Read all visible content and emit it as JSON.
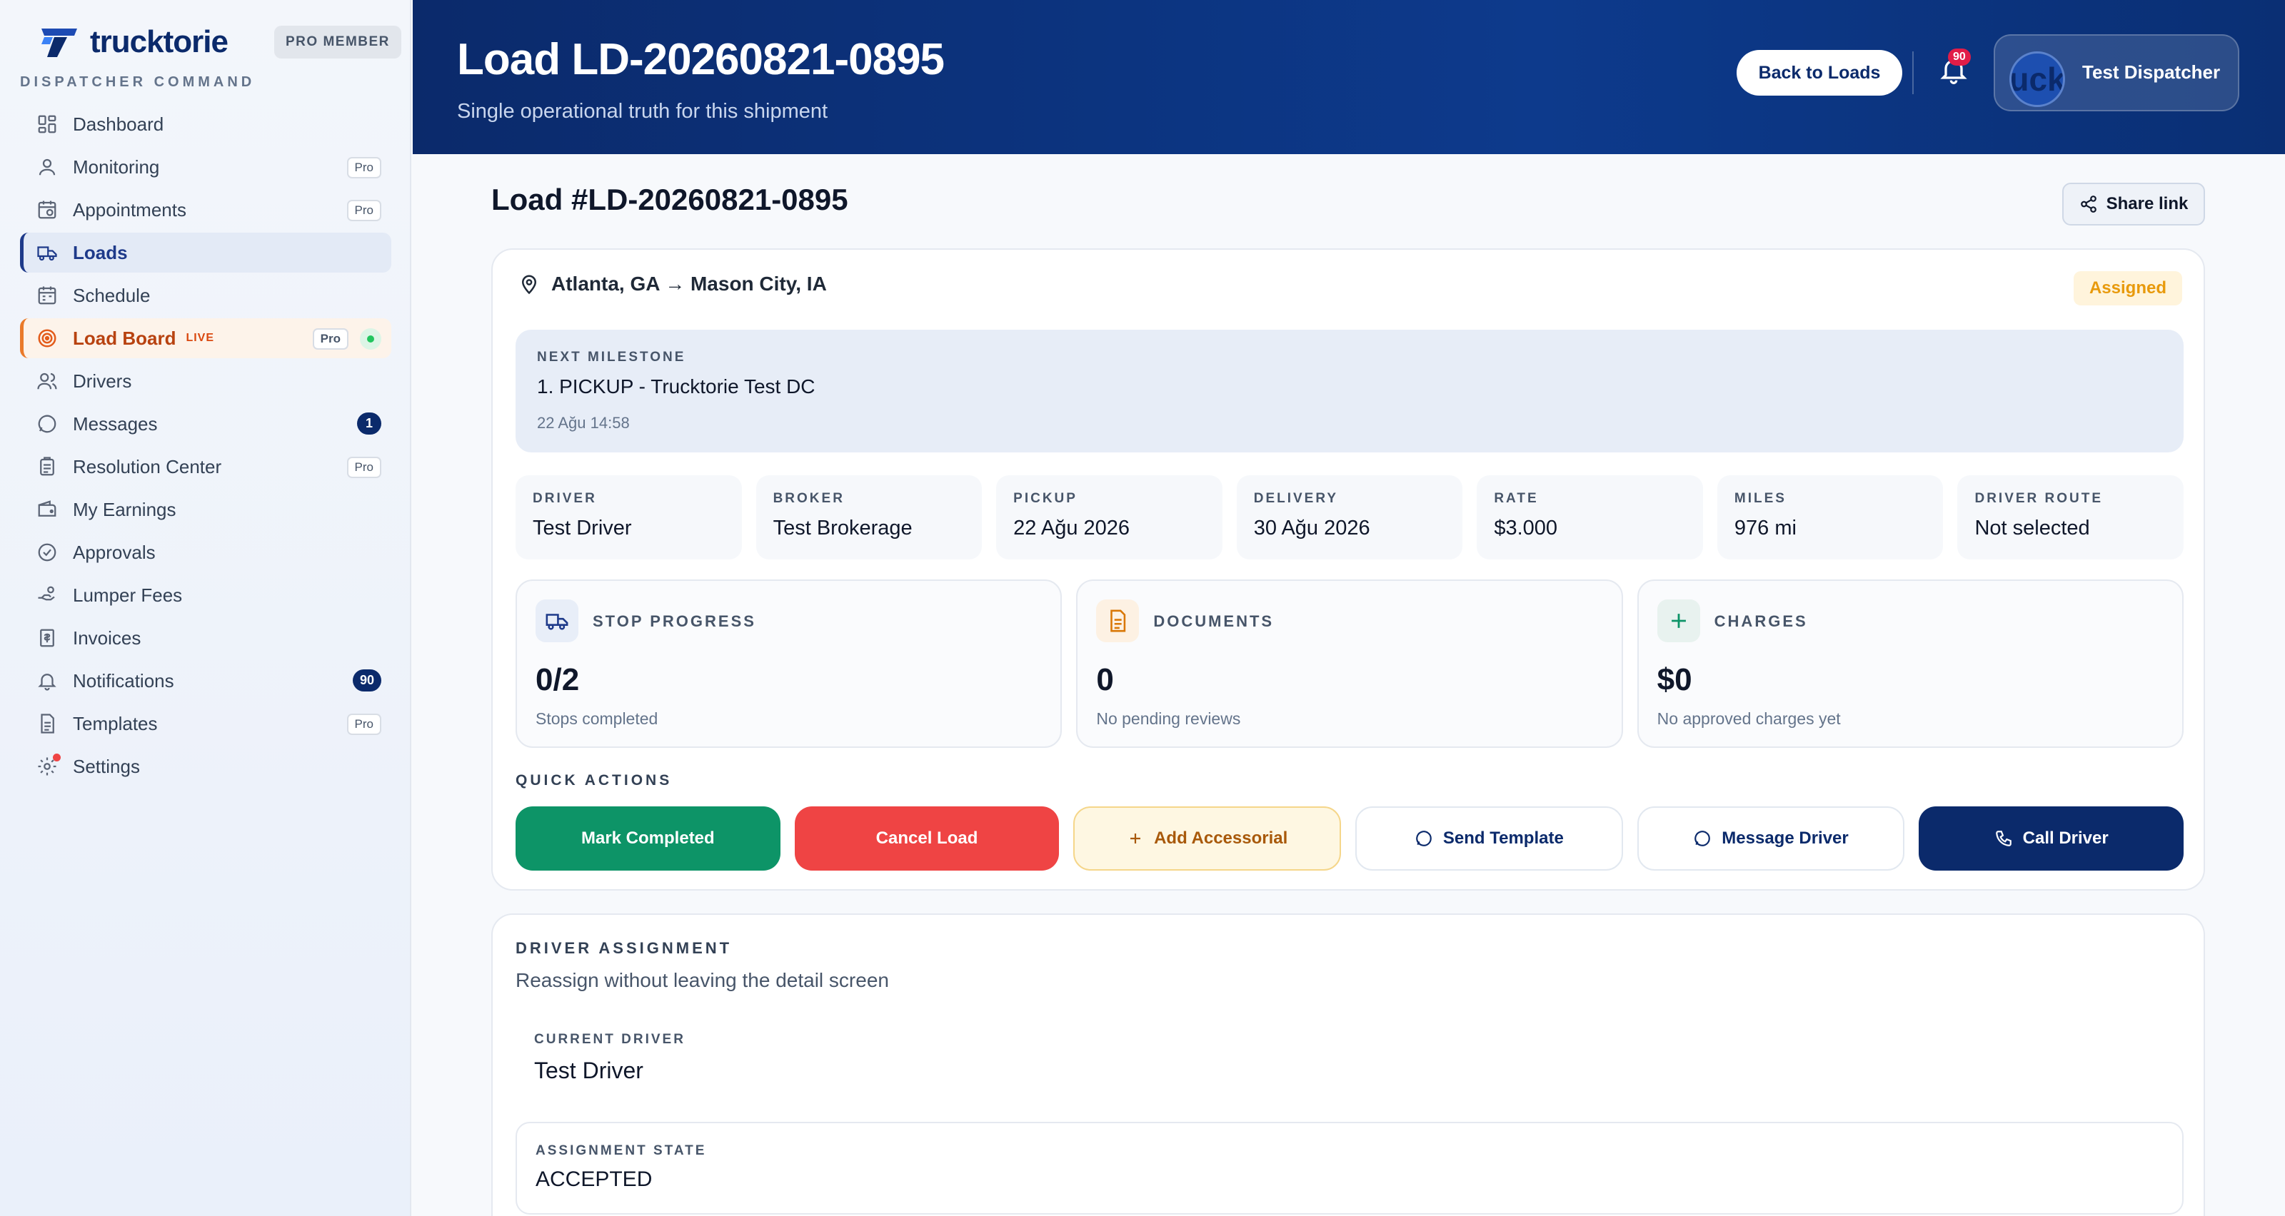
{
  "brand": {
    "name": "trucktorie",
    "badge": "PRO MEMBER",
    "section": "DISPATCHER COMMAND"
  },
  "sidebar": {
    "items": [
      {
        "label": "Dashboard",
        "icon": "dashboard-icon"
      },
      {
        "label": "Monitoring",
        "icon": "monitoring-icon",
        "tag": "Pro"
      },
      {
        "label": "Appointments",
        "icon": "calendar-clock-icon",
        "tag": "Pro"
      },
      {
        "label": "Loads",
        "icon": "truck-icon",
        "active": true
      },
      {
        "label": "Schedule",
        "icon": "calendar-icon"
      },
      {
        "label": "Load Board",
        "icon": "target-icon",
        "live": "LIVE",
        "tag": "Pro"
      },
      {
        "label": "Drivers",
        "icon": "users-icon"
      },
      {
        "label": "Messages",
        "icon": "chat-icon",
        "count": "1"
      },
      {
        "label": "Resolution Center",
        "icon": "clipboard-icon",
        "tag": "Pro"
      },
      {
        "label": "My Earnings",
        "icon": "wallet-icon"
      },
      {
        "label": "Approvals",
        "icon": "check-circle-icon"
      },
      {
        "label": "Lumper Fees",
        "icon": "hand-coins-icon"
      },
      {
        "label": "Invoices",
        "icon": "receipt-icon"
      },
      {
        "label": "Notifications",
        "icon": "bell-icon",
        "count": "90"
      },
      {
        "label": "Templates",
        "icon": "document-icon",
        "tag": "Pro"
      },
      {
        "label": "Settings",
        "icon": "gear-icon"
      }
    ]
  },
  "header": {
    "title": "Load LD-20260821-0895",
    "subtitle": "Single operational truth for this shipment",
    "back_label": "Back to Loads",
    "bell_count": "90",
    "avatar_text": "uck",
    "user_name": "Test Dispatcher"
  },
  "load": {
    "heading": "Load #LD-20260821-0895",
    "share_label": "Share link",
    "route": "Atlanta, GA → Mason City, IA",
    "status": "Assigned",
    "milestone": {
      "label": "NEXT MILESTONE",
      "title": "1. PICKUP - Trucktorie Test DC",
      "date": "22 Ağu 14:58"
    },
    "stats": [
      {
        "label": "DRIVER",
        "value": "Test Driver"
      },
      {
        "label": "BROKER",
        "value": "Test Brokerage"
      },
      {
        "label": "PICKUP",
        "value": "22 Ağu 2026"
      },
      {
        "label": "DELIVERY",
        "value": "30 Ağu 2026"
      },
      {
        "label": "RATE",
        "value": "$3.000"
      },
      {
        "label": "MILES",
        "value": "976 mi"
      },
      {
        "label": "DRIVER ROUTE",
        "value": "Not selected"
      }
    ],
    "kpis": [
      {
        "label": "STOP PROGRESS",
        "value": "0/2",
        "sub": "Stops completed",
        "icon": "truck-icon"
      },
      {
        "label": "DOCUMENTS",
        "value": "0",
        "sub": "No pending reviews",
        "icon": "document-icon"
      },
      {
        "label": "CHARGES",
        "value": "$0",
        "sub": "No approved charges yet",
        "icon": "plus-icon"
      }
    ],
    "quick_actions_label": "QUICK ACTIONS",
    "actions": [
      {
        "label": "Mark Completed"
      },
      {
        "label": "Cancel Load"
      },
      {
        "label": "Add Accessorial",
        "icon": "plus-icon"
      },
      {
        "label": "Send Template",
        "icon": "chat-icon"
      },
      {
        "label": "Message Driver",
        "icon": "chat-icon"
      },
      {
        "label": "Call Driver",
        "icon": "phone-icon"
      }
    ]
  },
  "assignment": {
    "label": "DRIVER ASSIGNMENT",
    "subtitle": "Reassign without leaving the detail screen",
    "current_label": "CURRENT DRIVER",
    "current_value": "Test Driver",
    "state_label": "ASSIGNMENT STATE",
    "state_value": "ACCEPTED"
  },
  "colors": {
    "navy": "#0b2a6b",
    "green": "#0d9467",
    "red": "#ef4444",
    "amber": "#e89a0c",
    "orange": "#ea7a2a"
  }
}
